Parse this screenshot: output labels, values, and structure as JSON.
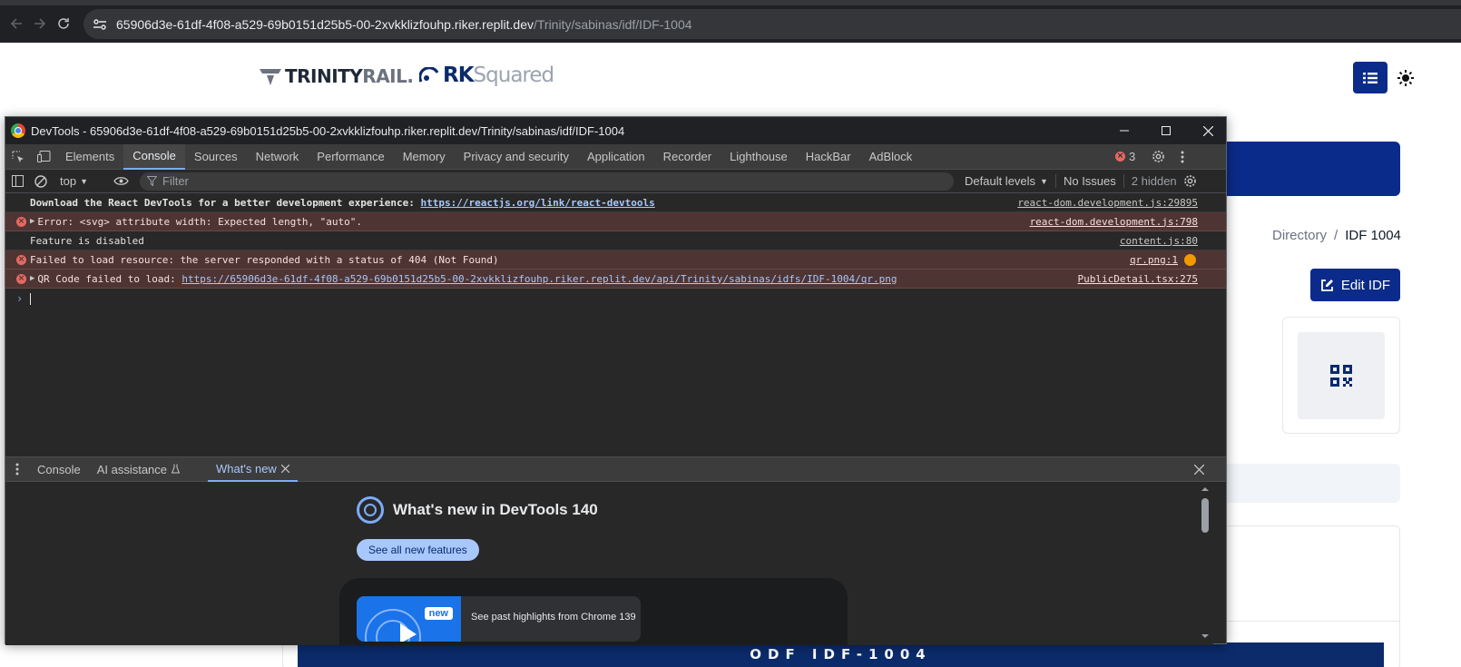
{
  "browser": {
    "url_host": "65906d3e-61df-4f08-a529-69b0151d25b5-00-2xvkklizfouhp.riker.replit.dev",
    "url_path": "/Trinity/sabinas/idf/IDF-1004",
    "back_icon": "arrow-left-icon",
    "forward_icon": "arrow-right-icon",
    "reload_icon": "reload-icon"
  },
  "page": {
    "logo_trinity_main": "TRINITY",
    "logo_trinity_rail": "RAIL.",
    "logo_rk_main": "RK",
    "logo_rk_rest": "Squared",
    "breadcrumb": {
      "parent": "Directory",
      "separator": "/",
      "current": "IDF 1004"
    },
    "edit_button_label": "Edit IDF",
    "odf_banner": "ODF IDF-1004",
    "brand_color": "#0b2b8a"
  },
  "devtools": {
    "window_title": "DevTools - 65906d3e-61df-4f08-a529-69b0151d25b5-00-2xvkklizfouhp.riker.replit.dev/Trinity/sabinas/idf/IDF-1004",
    "tabs": [
      "Elements",
      "Console",
      "Sources",
      "Network",
      "Performance",
      "Memory",
      "Privacy and security",
      "Application",
      "Recorder",
      "Lighthouse",
      "HackBar",
      "AdBlock"
    ],
    "active_tab": "Console",
    "error_count": "3",
    "toolbar": {
      "context": "top",
      "filter_placeholder": "Filter",
      "levels": "Default levels",
      "issues": "No Issues",
      "hidden": "2 hidden"
    },
    "logs": [
      {
        "type": "info",
        "expandable": false,
        "text": "Download the React DevTools for a better development experience: ",
        "link": "https://reactjs.org/link/react-devtools",
        "source": "react-dom.development.js:29895"
      },
      {
        "type": "error",
        "expandable": true,
        "text": "Error: <svg> attribute width: Expected length, \"auto\".",
        "link": "",
        "source": "react-dom.development.js:798"
      },
      {
        "type": "info",
        "expandable": false,
        "text": "Feature is disabled",
        "link": "",
        "source": "content.js:80"
      },
      {
        "type": "error",
        "expandable": false,
        "text": "Failed to load resource: the server responded with a status of 404 (Not Found)",
        "link": "",
        "source": "qr.png:1"
      },
      {
        "type": "error",
        "expandable": true,
        "text": "QR Code failed to load: ",
        "link": "https://65906d3e-61df-4f08-a529-69b0151d25b5-00-2xvkklizfouhp.riker.replit.dev/api/Trinity/sabinas/idfs/IDF-1004/qr.png",
        "source": "PublicDetail.tsx:275"
      }
    ],
    "drawer": {
      "tabs": [
        {
          "label": "Console",
          "active": false,
          "flask": false,
          "closable": false
        },
        {
          "label": "AI assistance",
          "active": false,
          "flask": true,
          "closable": false
        },
        {
          "label": "What's new",
          "active": true,
          "flask": false,
          "closable": true
        }
      ]
    },
    "whats_new": {
      "title": "What's new in DevTools 140",
      "button": "See all new features",
      "badge": "new",
      "highlight": "See past highlights from Chrome 139"
    }
  }
}
